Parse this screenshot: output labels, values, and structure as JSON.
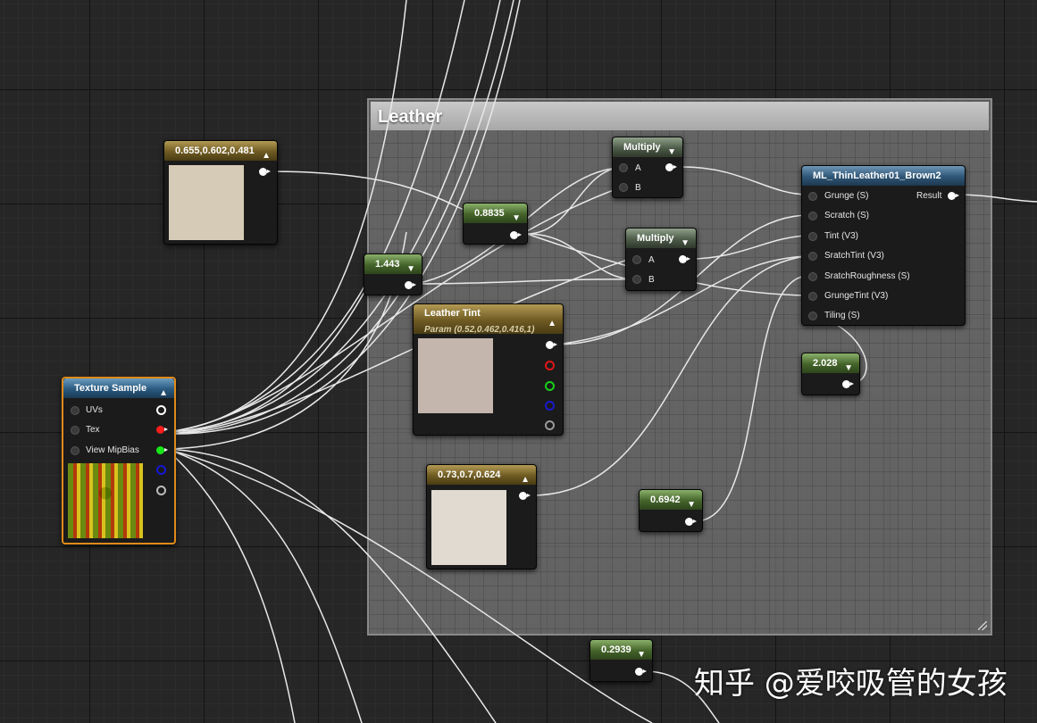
{
  "comment_box": {
    "title": "Leather"
  },
  "nodes": {
    "const_0655": {
      "title": "0.655,0.602,0.481",
      "color": "#d6cbb6"
    },
    "const_08835": {
      "title": "0.8835"
    },
    "const_1443": {
      "title": "1.443"
    },
    "multiply_1": {
      "title": "Multiply",
      "pin_a": "A",
      "pin_b": "B"
    },
    "multiply_2": {
      "title": "Multiply",
      "pin_a": "A",
      "pin_b": "B"
    },
    "leather_tint": {
      "title": "Leather Tint",
      "subtitle": "Param (0.52,0.462,0.416,1)",
      "color": "#c4b6ad"
    },
    "ml_function": {
      "title": "ML_ThinLeather01_Brown2",
      "inputs": [
        "Grunge (S)",
        "Scratch (S)",
        "Tint (V3)",
        "SratchTint (V3)",
        "SratchRoughness (S)",
        "GrungeTint (V3)",
        "Tiling (S)"
      ],
      "output": "Result"
    },
    "const_2028": {
      "title": "2.028"
    },
    "const_073": {
      "title": "0.73,0.7,0.624",
      "color": "#e0dad1"
    },
    "const_06942": {
      "title": "0.6942"
    },
    "const_02939": {
      "title": "0.2939"
    },
    "texture_sample": {
      "title": "Texture Sample",
      "inputs": [
        "UVs",
        "Tex",
        "View MipBias"
      ]
    }
  },
  "pin_colors": {
    "red": "#ff1d1d",
    "green": "#19e619",
    "blue": "#1717d9",
    "white": "#ffffff"
  },
  "watermark": "知乎 @爱咬吸管的女孩"
}
